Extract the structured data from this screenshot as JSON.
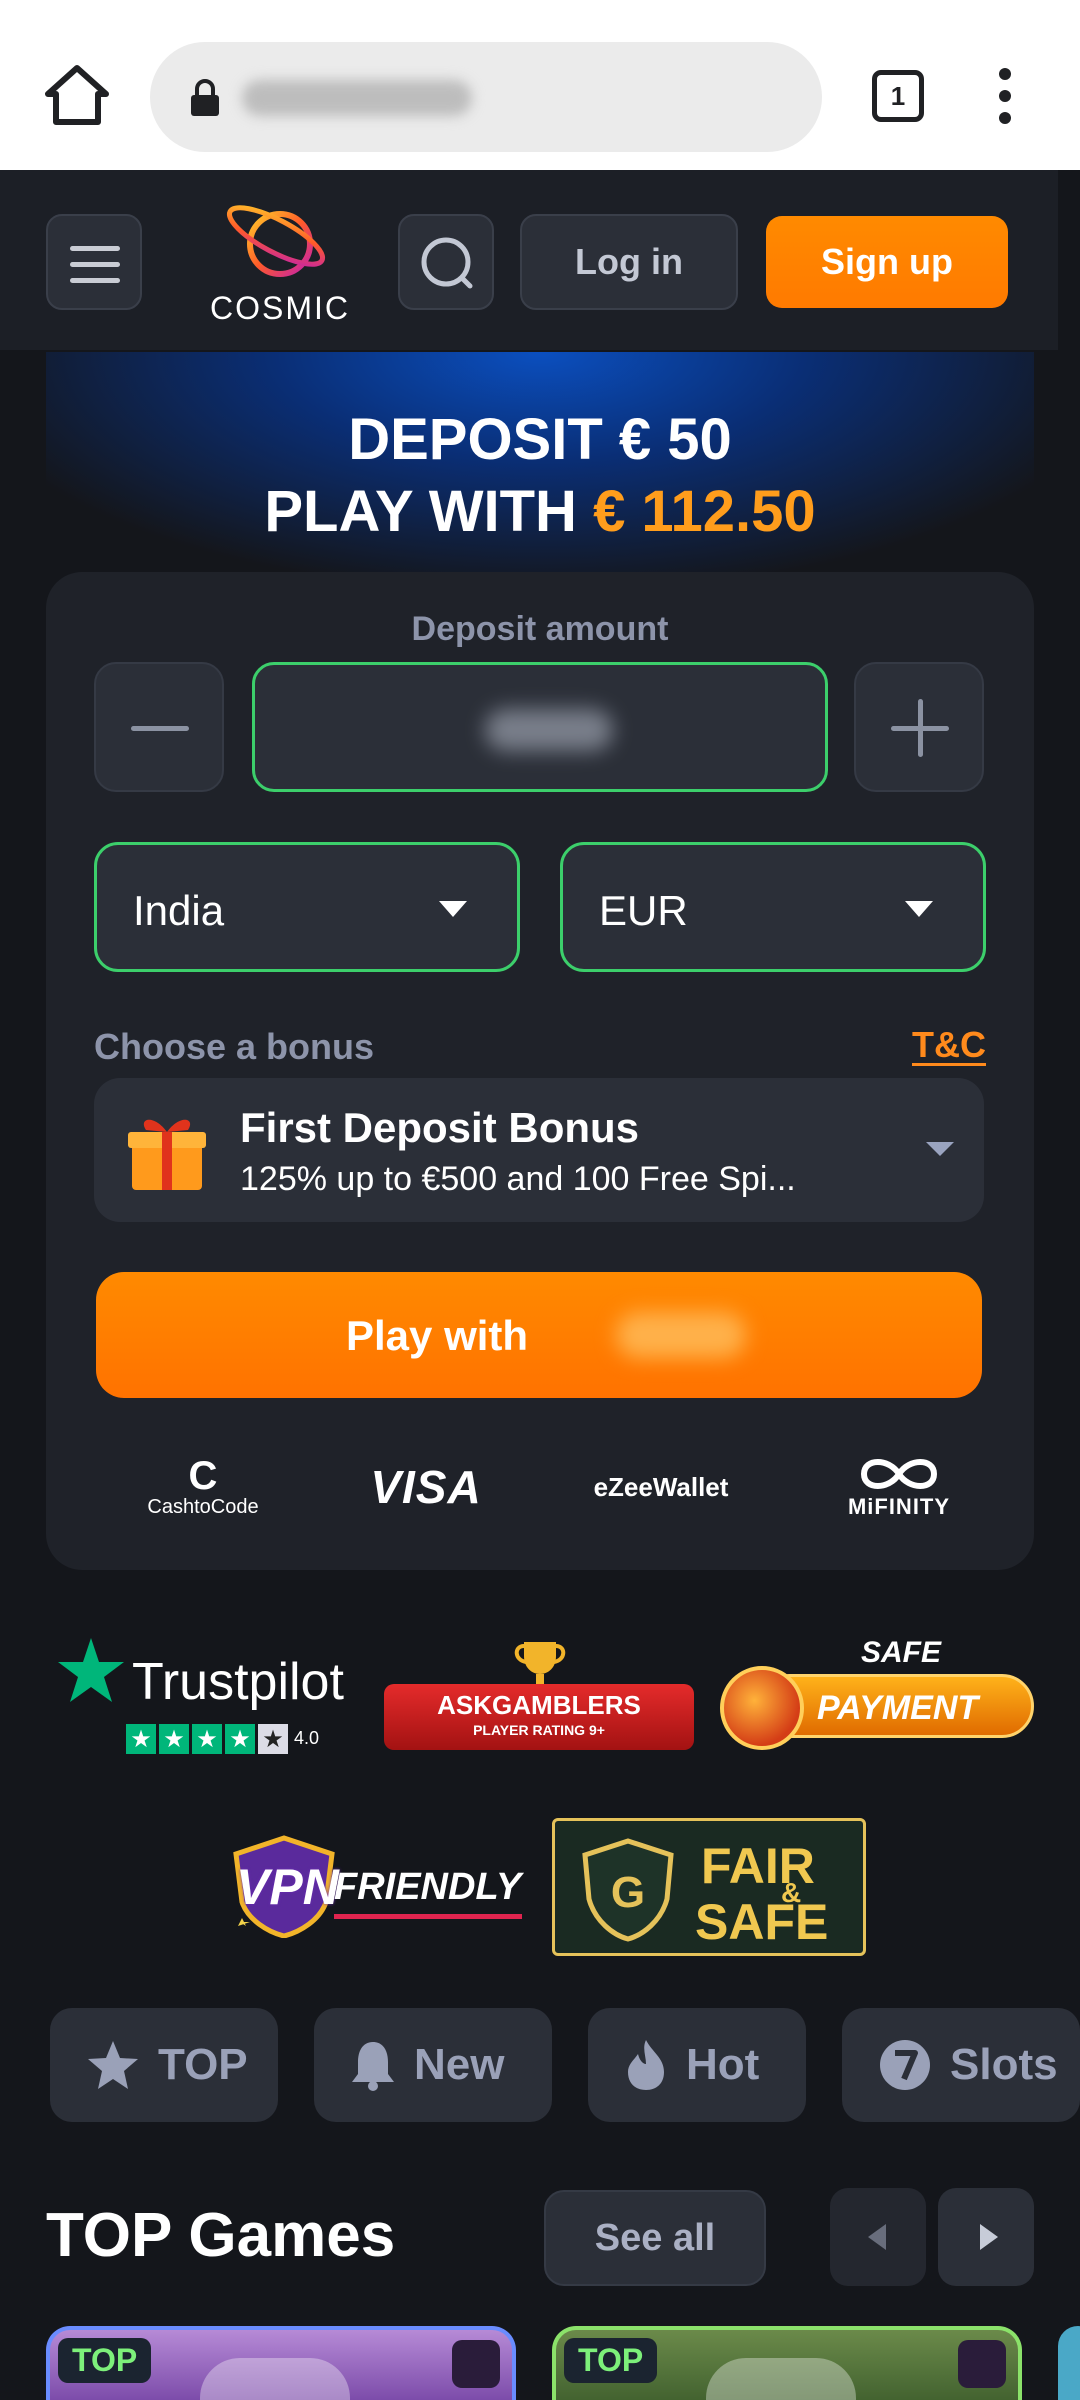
{
  "browser": {
    "tab_count": "1",
    "icons": [
      "home-icon",
      "lock-icon",
      "tabs-icon",
      "more-vert-icon"
    ]
  },
  "header": {
    "logo_text": "COSMIC",
    "login_label": "Log in",
    "signup_label": "Sign up"
  },
  "hero": {
    "line1": "DEPOSIT € 50",
    "line2_prefix": "PLAY WITH ",
    "line2_amount": "€ 112.50",
    "accent_color": "#ff9d1c"
  },
  "deposit": {
    "amount_label": "Deposit amount",
    "country": "India",
    "currency": "EUR",
    "bonus_label": "Choose a bonus",
    "tnc_label": "T&C",
    "bonus_title": "First Deposit Bonus",
    "bonus_desc": "125% up to €500 and 100 Free Spi...",
    "play_label": "Play with",
    "payment_methods": {
      "cashtocode_c": "C",
      "cashtocode": "CashtoCode",
      "visa": "VISA",
      "ezeewallet": "eZeeWallet",
      "mifinity": "MiFINITY"
    }
  },
  "badges": {
    "trustpilot": "Trustpilot",
    "trustpilot_rating": "4.0",
    "askgamblers": "ASKGAMBLERS",
    "askgamblers_sub": "PLAYER RATING 9+",
    "safe_top": "SAFE",
    "safe_bottom": "PAYMENT",
    "vpn_1": "VPN",
    "vpn_2": "FRIENDLY",
    "fair_1": "FAIR",
    "fair_amp": "&",
    "fair_2": "SAFE"
  },
  "categories": [
    {
      "label": "TOP",
      "icon": "star-icon"
    },
    {
      "label": "New",
      "icon": "bell-icon"
    },
    {
      "label": "Hot",
      "icon": "flame-icon"
    },
    {
      "label": "Slots",
      "icon": "seven-icon"
    }
  ],
  "games_section": {
    "title": "TOP Games",
    "see_all": "See all",
    "cards": [
      {
        "tag": "TOP"
      },
      {
        "tag": "TOP"
      }
    ]
  },
  "colors": {
    "brand_orange": "#ff8a00",
    "input_border_green": "#3ccf6b",
    "background": "#14161b"
  }
}
